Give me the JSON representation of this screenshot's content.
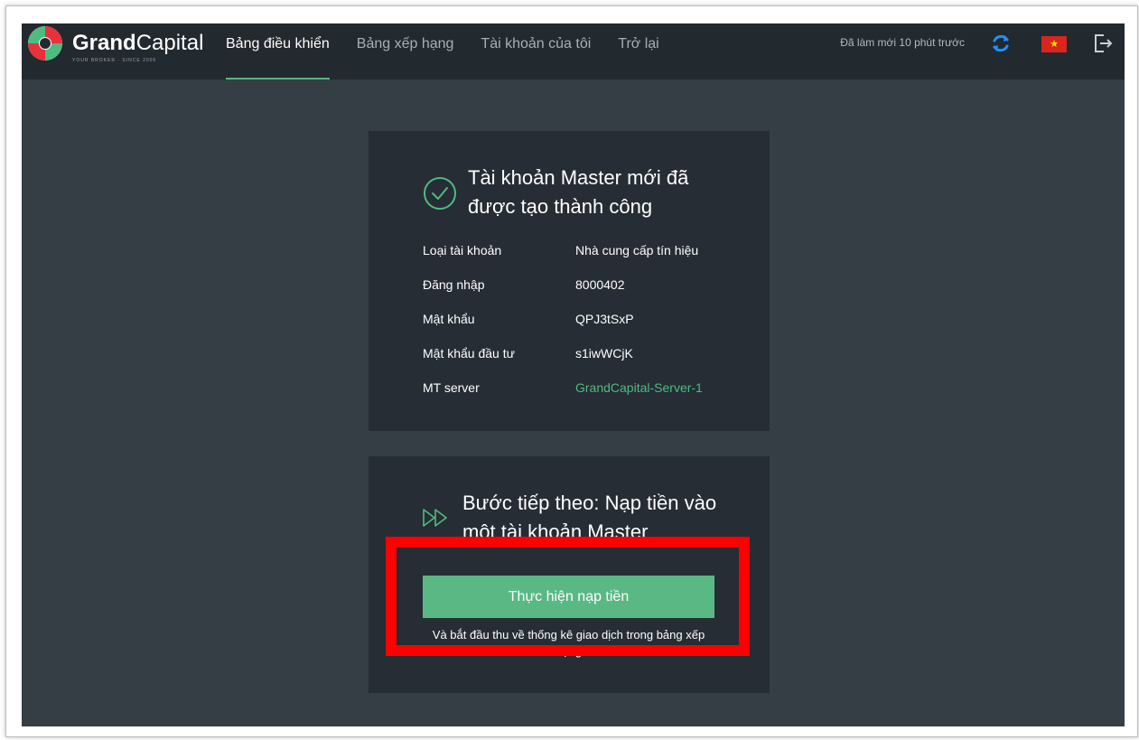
{
  "header": {
    "logo": {
      "bold": "Grand",
      "light": "Capital",
      "tagline": "YOUR BROKER · SINCE 2006"
    },
    "nav": [
      {
        "label": "Bảng điều khiển",
        "active": true
      },
      {
        "label": "Bảng xếp hạng",
        "active": false
      },
      {
        "label": "Tài khoản của tôi",
        "active": false
      },
      {
        "label": "Trở lại",
        "active": false
      }
    ],
    "refresh_status": "Đã làm mới 10 phút trước",
    "icons": {
      "refresh": "refresh-icon",
      "language": "vietnam-flag-icon",
      "logout": "logout-icon"
    },
    "flag_star": "★"
  },
  "account_card": {
    "title": "Tài khoản Master mới đã được tạo thành công",
    "icon": "check-circle-icon",
    "rows": [
      {
        "label": "Loại tài khoản",
        "value": "Nhà cung cấp tín hiệu"
      },
      {
        "label": "Đăng nhập",
        "value": "8000402"
      },
      {
        "label": "Mật khẩu",
        "value": "QPJ3tSxP"
      },
      {
        "label": "Mật khẩu đầu tư",
        "value": "s1iwWCjK"
      },
      {
        "label": "MT server",
        "value": "GrandCapital-Server-1"
      }
    ]
  },
  "next_step_card": {
    "icon": "fast-forward-icon",
    "title": "Bước tiếp theo: Nạp tiền vào một tài khoản Master",
    "button_label": "Thực hiện nạp tiền",
    "sub_text": "Và bắt đầu thu về thống kê giao dịch trong bảng xếp hạng"
  },
  "colors": {
    "background": "#353d45",
    "topbar": "#22292f",
    "card": "#262d34",
    "accent": "#5ab884",
    "link": "#4fbb80",
    "highlight": "#ff0000",
    "flag": "#da251d",
    "refresh_icon": "#1e90ff"
  }
}
